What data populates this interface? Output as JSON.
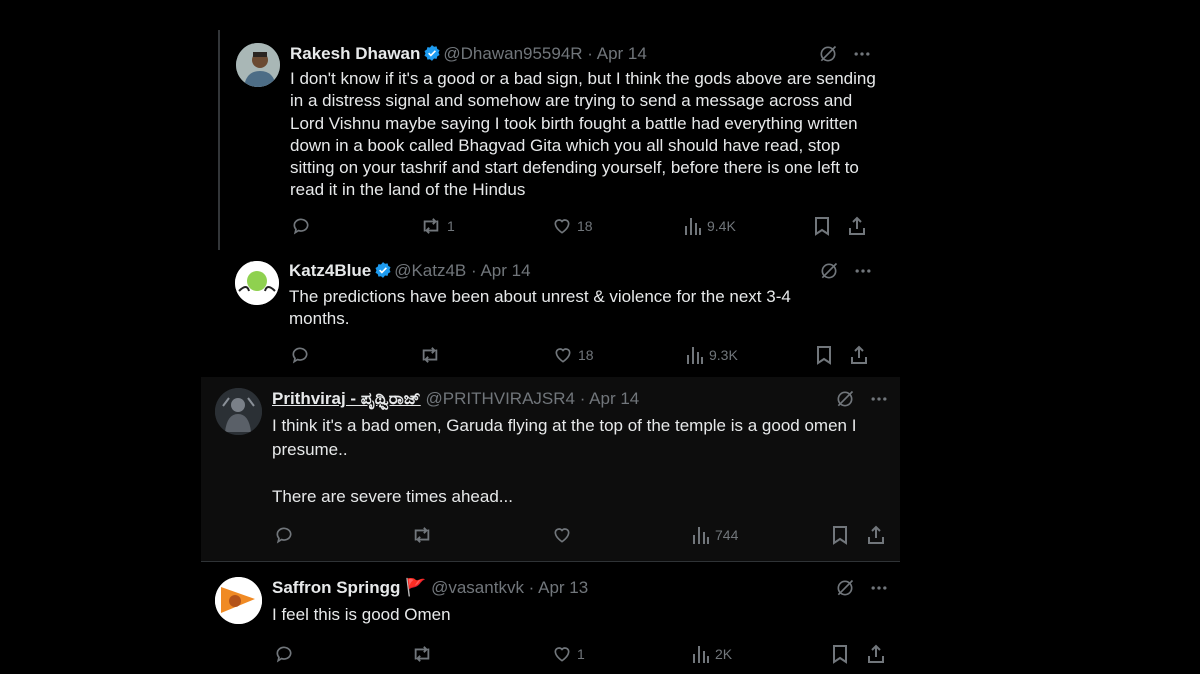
{
  "posts": [
    {
      "name": "Rakesh Dhawan",
      "handle": "@Dhawan95594R",
      "date": "Apr 14",
      "verified": true,
      "text": "I don't know if it's a good or a bad sign, but I think the gods above are sending in a distress signal and somehow are trying to send a message across and Lord Vishnu maybe saying I took birth fought a battle had everything written down in a book called Bhagvad Gita which you all should have read, stop sitting on your tashrif and start defending yourself, before there is one left to read it in the land of the Hindus",
      "reposts": "1",
      "likes": "18",
      "views": "9.4K"
    },
    {
      "name": "Katz4Blue",
      "handle": "@Katz4B",
      "date": "Apr 14",
      "verified": true,
      "text": "The predictions have been about unrest & violence for the next 3-4 months.",
      "reposts": "",
      "likes": "18",
      "views": "9.3K"
    },
    {
      "name": "Prithviraj - ಪೃಥ್ವಿರಾಜ್",
      "handle": "@PRITHVIRAJSR4",
      "date": "Apr 14",
      "verified": false,
      "text": "I think it's a bad omen, Garuda flying at the top of the temple is a good omen I presume..\n\nThere are severe times ahead...",
      "reposts": "",
      "likes": "",
      "views": "744"
    },
    {
      "name": "Saffron Springg",
      "handle": "@vasantkvk",
      "date": "Apr 13",
      "verified": false,
      "flag": "🚩",
      "text": "I feel this is good Omen",
      "reposts": "",
      "likes": "1",
      "views": "2K"
    }
  ],
  "separator": " · ",
  "colors": {
    "verified": "#1d9bf0",
    "muted": "#71767b",
    "text": "#e7e9ea",
    "flag": "#e0245e"
  }
}
